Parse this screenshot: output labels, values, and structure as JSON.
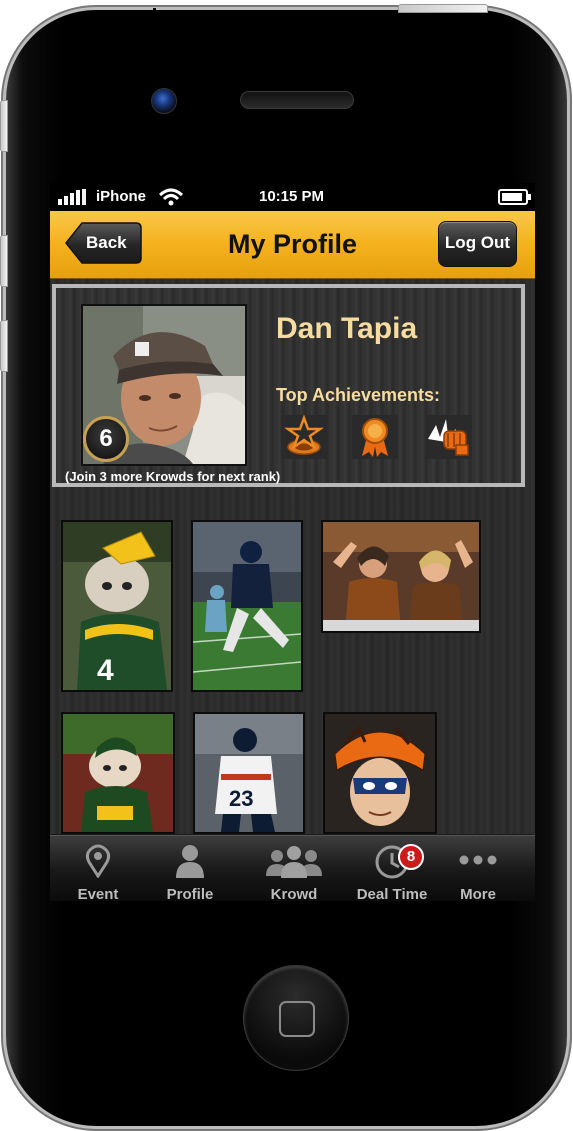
{
  "status_bar": {
    "carrier": "iPhone",
    "time": "10:15 PM",
    "icons": [
      "signal-icon",
      "wifi-icon",
      "battery-icon"
    ]
  },
  "nav": {
    "title": "My Profile",
    "back_label": "Back",
    "logout_label": "Log Out",
    "bar_color": "#f4b11d"
  },
  "profile": {
    "name": "Dan Tapia",
    "rank": "6",
    "achievements_label": "Top Achievements:",
    "rank_hint": "(Join 3 more Krowds for next rank)",
    "badges": [
      "star-badge-icon",
      "ribbon-award-icon",
      "fist-bump-icon"
    ],
    "accent_color": "#f6dca0"
  },
  "photos": [
    {
      "subject": "bulldog in green bay jersey with cheesehead"
    },
    {
      "subject": "seattle football player running"
    },
    {
      "subject": "cheering cleveland fans"
    },
    {
      "subject": "dog in green bay jersey"
    },
    {
      "subject": "chicago player number 23"
    },
    {
      "subject": "fan with orange painted face and hat"
    }
  ],
  "tabs": [
    {
      "label": "Event",
      "icon": "location-pin-icon"
    },
    {
      "label": "Profile",
      "icon": "person-icon"
    },
    {
      "label": "Krowd",
      "icon": "group-icon"
    },
    {
      "label": "Deal Time",
      "icon": "clock-icon",
      "badge": "8"
    },
    {
      "label": "More",
      "icon": "more-dots-icon"
    }
  ]
}
